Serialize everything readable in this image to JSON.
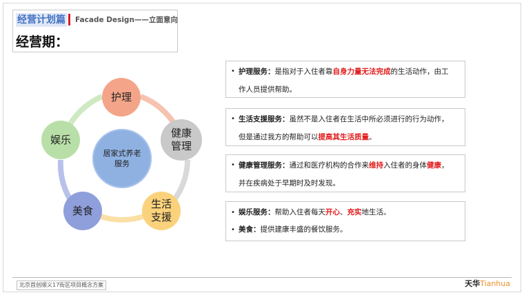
{
  "header": {
    "section": "经营计划篇",
    "subtitle": "Facade Design——立面意向",
    "period": "经营期："
  },
  "cycle": {
    "center": "居家式养老\n服务",
    "nodes": {
      "care": "护理",
      "health": "健康\n管理",
      "life": "生活\n支援",
      "food": "美食",
      "fun": "娱乐"
    },
    "colors": {
      "care": "#f4a488",
      "health": "#c9c9c9",
      "life": "#fbd27c",
      "food": "#8f9fdb",
      "fun": "#b9dfa8",
      "center": "#8fb1e2"
    }
  },
  "descriptions": {
    "bullet": "•",
    "care": {
      "title": "护理服务：",
      "pre": "是指对于入住者靠",
      "highlight": "自身力量无法完成",
      "post": "的生活动作，由工",
      "line2": "作人员提供帮助。"
    },
    "life": {
      "title": "生活支援服务：",
      "text": "虽然不是入住者在生活中所必须进行的行为动作，",
      "line2_pre": "但是通过我方的帮助可以",
      "line2_highlight": "提高其生活质量",
      "line2_post": "。"
    },
    "health": {
      "title": "健康管理服务：",
      "pre": "通过和医疗机构的合作来",
      "hl1": "维持",
      "mid": "入住者的身体",
      "hl2": "健康",
      "post": "，",
      "line2": "并在疾病处于早期时及时发现。"
    },
    "fun": {
      "title": "娱乐服务：",
      "pre": "帮助入住者每天",
      "hl1": "开心",
      "sep": "、",
      "hl2": "充实",
      "post": "地生活。"
    },
    "food": {
      "title": "美食：",
      "text": "提供建康丰盛的餐饮服务。"
    }
  },
  "footer": {
    "project": "北京首创顺义17街区项目概念方案",
    "logo_cn": "天华",
    "logo_en": "Tianhua"
  }
}
